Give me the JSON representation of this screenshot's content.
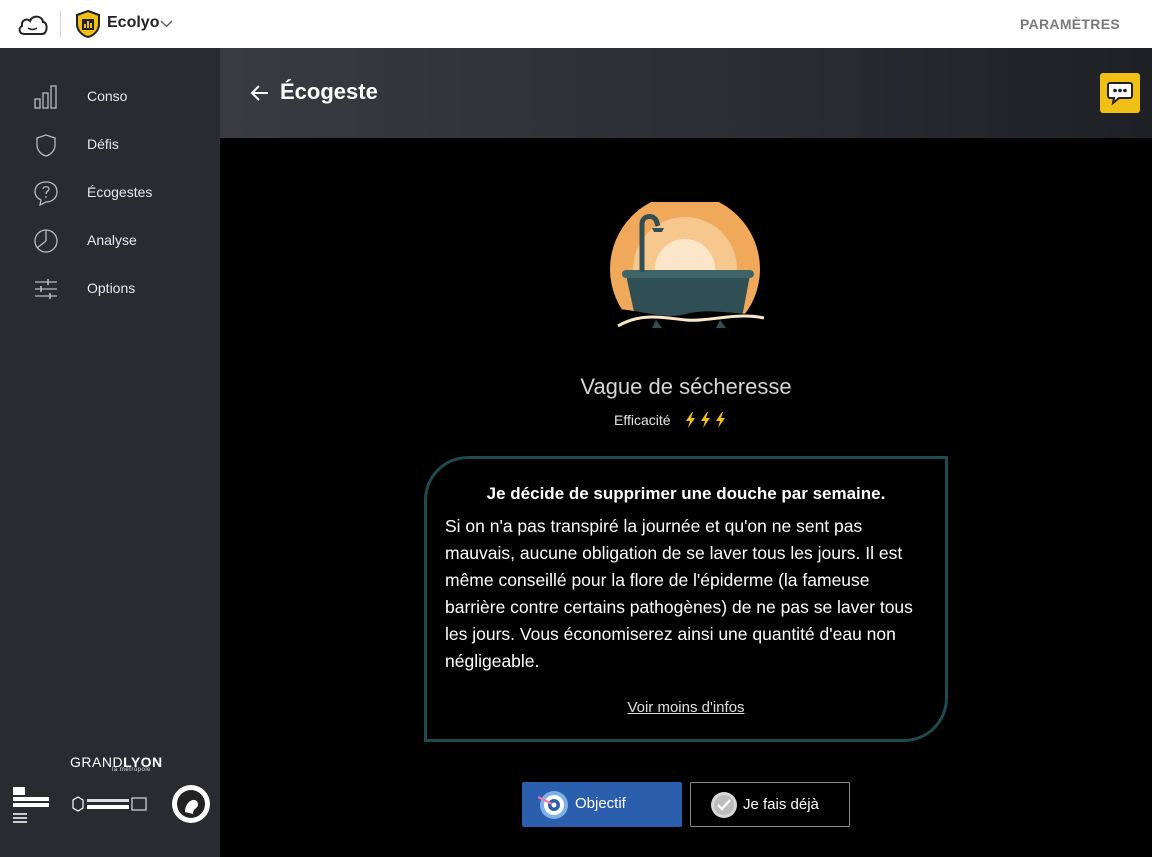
{
  "topbar": {
    "app_name": "Ecolyo",
    "settings_label": "PARAMÈTRES"
  },
  "sidebar": {
    "items": [
      {
        "label": "Conso",
        "icon": "bar-chart-icon"
      },
      {
        "label": "Défis",
        "icon": "shield-icon"
      },
      {
        "label": "Écogestes",
        "icon": "question-bubble-icon"
      },
      {
        "label": "Analyse",
        "icon": "pie-chart-icon"
      },
      {
        "label": "Options",
        "icon": "sliders-icon"
      }
    ],
    "partners": {
      "grandlyon_a": "GRAND",
      "grandlyon_b": "LYON",
      "grandlyon_sub": "la métropole"
    }
  },
  "header": {
    "title": "Écogeste"
  },
  "ecogeste": {
    "name": "Vague de sécheresse",
    "efficacite_label": "Efficacité",
    "efficacite_level": 3,
    "short_description": "Je décide de supprimer une douche par semaine.",
    "long_description": "Si on n'a pas transpiré la journée et qu'on ne sent pas mauvais, aucune obligation de se laver tous les jours. Il est même conseillé pour la flore de l'épiderme (la fameuse barrière contre certains pathogènes) de ne pas se laver tous les jours. Vous économiserez ainsi une quantité d'eau non négligeable.",
    "toggle_link": "Voir moins d'infos"
  },
  "actions": {
    "objective_label": "Objectif",
    "already_label": "Je fais déjà"
  },
  "colors": {
    "accent_blue": "#2b5fad",
    "feedback_yellow": "#f1c017",
    "card_border": "#1f4a4f",
    "sidebar_bg": "#2a2b30"
  }
}
